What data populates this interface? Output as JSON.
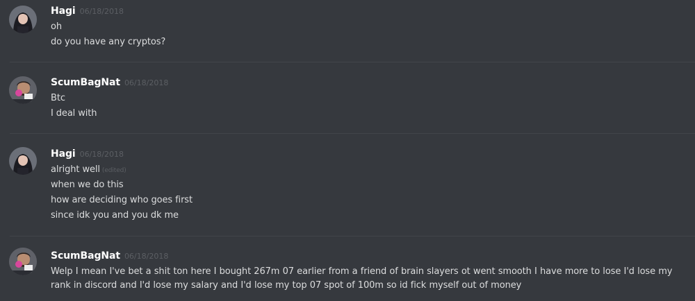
{
  "groups": [
    {
      "author": "Hagi",
      "timestamp": "06/18/2018",
      "avatar_icon": "hagi-avatar",
      "messages": [
        {
          "text": "oh"
        },
        {
          "text": "do you have any cryptos?"
        }
      ]
    },
    {
      "author": "ScumBagNat",
      "timestamp": "06/18/2018",
      "avatar_icon": "scumbagnat-avatar",
      "messages": [
        {
          "text": "Btc"
        },
        {
          "text": "I deal with"
        }
      ]
    },
    {
      "author": "Hagi",
      "timestamp": "06/18/2018",
      "avatar_icon": "hagi-avatar",
      "messages": [
        {
          "text": "alright well",
          "edited": "(edited)"
        },
        {
          "text": "when we do this"
        },
        {
          "text": "how are deciding who goes first"
        },
        {
          "text": "since idk you and you dk me"
        }
      ]
    },
    {
      "author": "ScumBagNat",
      "timestamp": "06/18/2018",
      "avatar_icon": "scumbagnat-avatar",
      "messages": [
        {
          "text": "Welp I mean I've bet a shit ton here I bought 267m 07 earlier from a friend of brain slayers  ot went smooth I have more to lose I'd lose my rank in discord and I'd lose my salary and I'd lose my top 07 spot of 100m so id fick myself out of money"
        }
      ]
    }
  ],
  "colors": {
    "background": "#36393e",
    "divider": "#42454a",
    "username": "#ffffff",
    "message": "#dcddde",
    "timestamp": "#5c5f64"
  }
}
